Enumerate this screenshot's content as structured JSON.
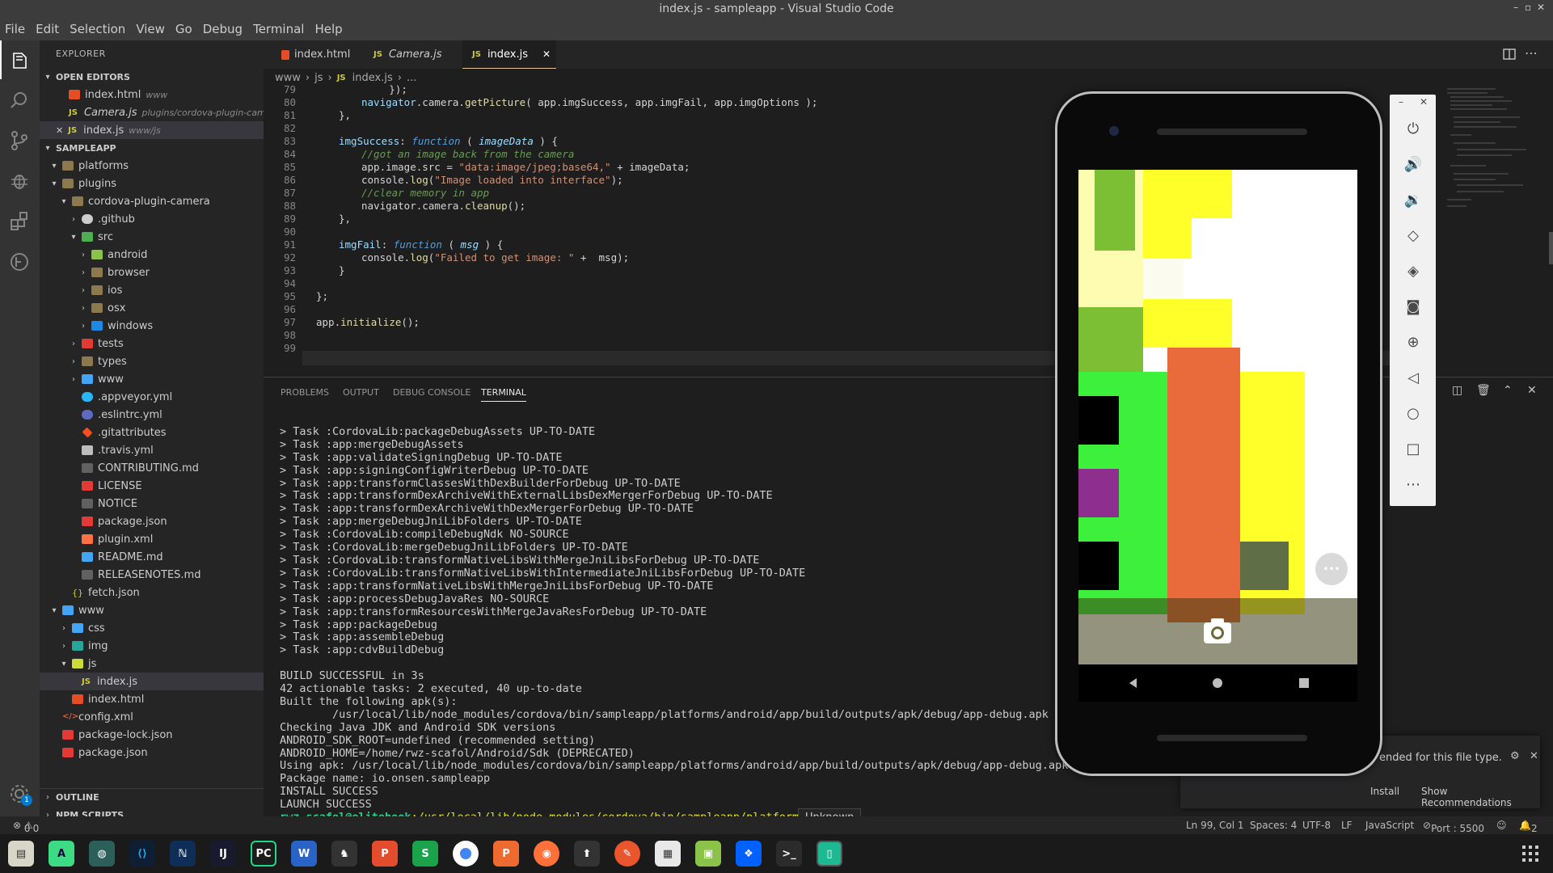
{
  "window": {
    "title": "index.js - sampleapp - Visual Studio Code"
  },
  "menu": [
    "File",
    "Edit",
    "Selection",
    "View",
    "Go",
    "Debug",
    "Terminal",
    "Help"
  ],
  "sidebar": {
    "header": "EXPLORER",
    "open_editors_title": "OPEN EDITORS",
    "open_editors": [
      {
        "name": "index.html",
        "path": "www"
      },
      {
        "name": "Camera.js",
        "path": "plugins/cordova-plugin-cam..."
      },
      {
        "name": "index.js",
        "path": "www/js"
      }
    ],
    "project_title": "SAMPLEAPP",
    "tree": [
      "platforms",
      "plugins",
      "cordova-plugin-camera",
      ".github",
      "src",
      "android",
      "browser",
      "ios",
      "osx",
      "windows",
      "tests",
      "types",
      "www",
      ".appveyor.yml",
      ".eslintrc.yml",
      ".gitattributes",
      ".travis.yml",
      "CONTRIBUTING.md",
      "LICENSE",
      "NOTICE",
      "package.json",
      "plugin.xml",
      "README.md",
      "RELEASENOTES.md",
      "fetch.json",
      "www",
      "css",
      "img",
      "js",
      "index.js",
      "index.html",
      "config.xml",
      "package-lock.json",
      "package.json"
    ],
    "outline_title": "OUTLINE",
    "npm_title": "NPM SCRIPTS"
  },
  "tabs": [
    "index.html",
    "Camera.js",
    "index.js"
  ],
  "breadcrumb": [
    "www",
    "js",
    "index.js",
    "..."
  ],
  "code": {
    "line_numbers": [
      "79",
      "80",
      "81",
      "82",
      "83",
      "84",
      "85",
      "86",
      "87",
      "88",
      "89",
      "90",
      "91",
      "92",
      "93",
      "94",
      "95",
      "96",
      "97",
      "98",
      "99"
    ],
    "l79": "            });",
    "l80a": "navigator",
    "l80b": ".camera.",
    "l80c": "getPicture",
    "l80d": "( app.imgSuccess, app.imgFail, app.imgOptions );",
    "l81": "},",
    "l83a": "imgSuccess",
    "l83b": ": ",
    "l83c": "function",
    "l83d": " ( ",
    "l83e": "imageData",
    "l83f": " ) {",
    "l84": "//got an image back from the camera",
    "l85a": "app.image.src = ",
    "l85b": "\"data:image/jpeg;base64,\"",
    "l85c": " + imageData;",
    "l86a": "console.",
    "l86b": "log",
    "l86c": "(",
    "l86d": "\"Image loaded into interface\"",
    "l86e": ");",
    "l87": "//clear memory in app",
    "l88a": "navigator.camera.",
    "l88b": "cleanup",
    "l88c": "();",
    "l89": "},",
    "l91a": "imgFail",
    "l91b": ": ",
    "l91c": "function",
    "l91d": " ( ",
    "l91e": "msg",
    "l91f": " ) {",
    "l92a": "console.",
    "l92b": "log",
    "l92c": "(",
    "l92d": "\"Failed to get image: \"",
    "l92e": " +  msg);",
    "l93": "}",
    "l95": "};",
    "l97a": "app.",
    "l97b": "initialize",
    "l97c": "();"
  },
  "panel": {
    "tabs": [
      "PROBLEMS",
      "OUTPUT",
      "DEBUG CONSOLE",
      "TERMINAL"
    ],
    "terminal_lines": [
      "> Task :CordovaLib:packageDebugAssets UP-TO-DATE",
      "> Task :app:mergeDebugAssets",
      "> Task :app:validateSigningDebug UP-TO-DATE",
      "> Task :app:signingConfigWriterDebug UP-TO-DATE",
      "> Task :app:transformClassesWithDexBuilderForDebug UP-TO-DATE",
      "> Task :app:transformDexArchiveWithExternalLibsDexMergerForDebug UP-TO-DATE",
      "> Task :app:transformDexArchiveWithDexMergerForDebug UP-TO-DATE",
      "> Task :app:mergeDebugJniLibFolders UP-TO-DATE",
      "> Task :CordovaLib:compileDebugNdk NO-SOURCE",
      "> Task :CordovaLib:mergeDebugJniLibFolders UP-TO-DATE",
      "> Task :CordovaLib:transformNativeLibsWithMergeJniLibsForDebug UP-TO-DATE",
      "> Task :CordovaLib:transformNativeLibsWithIntermediateJniLibsForDebug UP-TO-DATE",
      "> Task :app:transformNativeLibsWithMergeJniLibsForDebug UP-TO-DATE",
      "> Task :app:processDebugJavaRes NO-SOURCE",
      "> Task :app:transformResourcesWithMergeJavaResForDebug UP-TO-DATE",
      "> Task :app:packageDebug",
      "> Task :app:assembleDebug",
      "> Task :app:cdvBuildDebug",
      "",
      "BUILD SUCCESSFUL in 3s",
      "42 actionable tasks: 2 executed, 40 up-to-date",
      "Built the following apk(s):",
      "        /usr/local/lib/node_modules/cordova/bin/sampleapp/platforms/android/app/build/outputs/apk/debug/app-debug.apk",
      "Checking Java JDK and Android SDK versions",
      "ANDROID_SDK_ROOT=undefined (recommended setting)",
      "ANDROID_HOME=/home/rwz-scafol/Android/Sdk (DEPRECATED)",
      "Using apk: /usr/local/lib/node_modules/cordova/bin/sampleapp/platforms/android/app/build/outputs/apk/debug/app-debug.apk",
      "Package name: io.onsen.sampleapp",
      "INSTALL SUCCESS",
      "LAUNCH SUCCESS"
    ],
    "prompt_user": "rwz-scafol@elitebook",
    "prompt_path": ":/usr/local/lib/node_modules/cordova/bin/sampleapp/platforms",
    "prompt_end": "$ "
  },
  "tooltip": "Unknown",
  "notification": {
    "text": "ended for this file type.",
    "install": "Install",
    "show_recommendations": "Show Recommendations"
  },
  "status": {
    "problems": "0",
    "warnings": "0",
    "position": "Ln 99, Col 1",
    "spaces": "Spaces: 4",
    "encoding": "UTF-8",
    "eol": "LF",
    "language": "JavaScript",
    "port": "Port : 5500",
    "notifications": "2"
  },
  "colors": {
    "accent": "#007acc",
    "statusbar": "#252526",
    "terminal_green": "#23d18b"
  }
}
